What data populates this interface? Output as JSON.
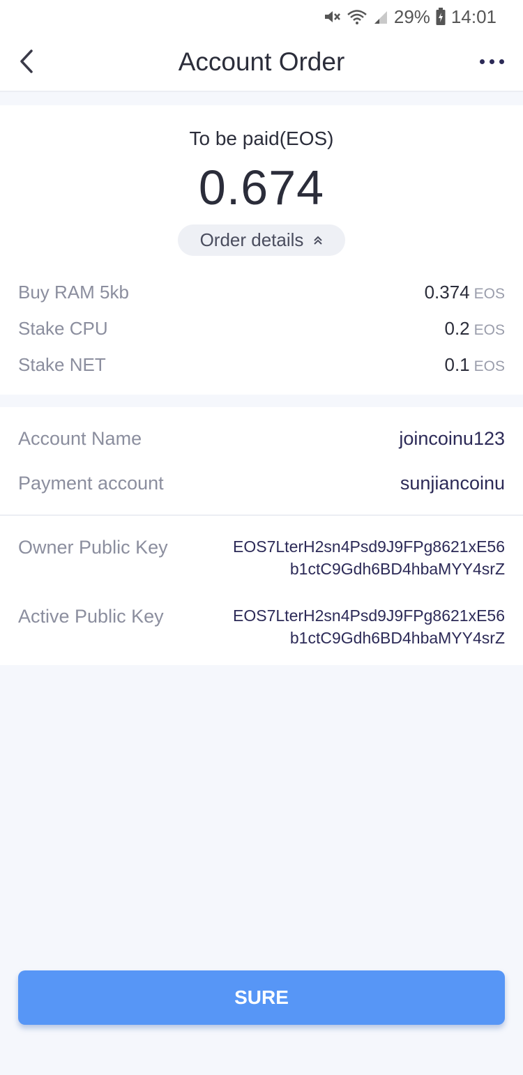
{
  "status_bar": {
    "battery": "29%",
    "time": "14:01",
    "icons": [
      "mute-icon",
      "wifi-icon",
      "signal-icon",
      "battery-icon"
    ]
  },
  "header": {
    "title": "Account Order",
    "back_icon": "chevron-left-icon",
    "more_icon": "more-dots-icon"
  },
  "payment": {
    "label": "To be paid(EOS)",
    "amount": "0.674",
    "details_toggle": "Order details",
    "toggle_icon": "double-chevron-up-icon",
    "items": [
      {
        "label": "Buy RAM 5kb",
        "value": "0.374",
        "unit": "EOS"
      },
      {
        "label": "Stake CPU",
        "value": "0.2",
        "unit": "EOS"
      },
      {
        "label": "Stake NET",
        "value": "0.1",
        "unit": "EOS"
      }
    ]
  },
  "account": {
    "name_label": "Account Name",
    "name_value": "joincoinu123",
    "payment_label": "Payment account",
    "payment_value": "sunjiancoinu",
    "owner_key_label": "Owner Public Key",
    "owner_key_line1": "EOS7LterH2sn4Psd9J9FPg8621xE56",
    "owner_key_line2": "b1ctC9Gdh6BD4hbaMYY4srZ",
    "active_key_label": "Active Public Key",
    "active_key_line1": "EOS7LterH2sn4Psd9J9FPg8621xE56",
    "active_key_line2": "b1ctC9Gdh6BD4hbaMYY4srZ"
  },
  "actions": {
    "confirm_label": "SURE"
  },
  "colors": {
    "primary": "#5796f6",
    "background": "#f5f7fc",
    "value_text": "#2c2a57",
    "label_text": "#8b8e9e"
  }
}
